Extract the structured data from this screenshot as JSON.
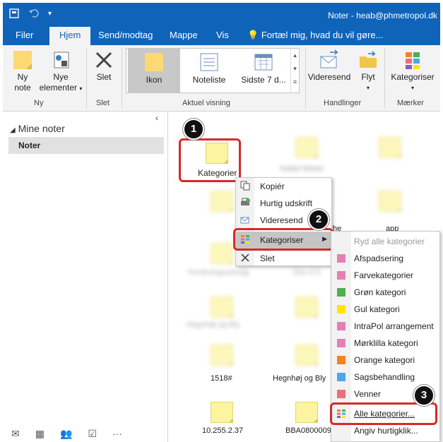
{
  "titlebar": {
    "title": "Noter - heab@phmetropol.dk"
  },
  "tabs": [
    "Filer",
    "Hjem",
    "Send/modtag",
    "Mappe",
    "Vis"
  ],
  "tell_me": "Fortæl mig, hvad du vil gøre...",
  "ribbon": {
    "ny_note_1": "Ny",
    "ny_note_2": "note",
    "nye_elementer_1": "Nye",
    "nye_elementer_2": "elementer",
    "slet": "Slet",
    "view_ikon": "Ikon",
    "view_noteliste": "Noteliste",
    "view_sidste": "Sidste 7 d...",
    "videresend": "Videresend",
    "flyt": "Flyt",
    "kategoriser": "Kategoriser",
    "groups": {
      "ny": "Ny",
      "slet": "Slet",
      "aktuel": "Aktuel visning",
      "handlinger": "Handlinger",
      "maerker": "Mærker"
    }
  },
  "nav": {
    "mine_noter": "Mine noter",
    "noter": "Noter"
  },
  "notes": {
    "selected": "Kategorier",
    "n_1518": "1518#",
    "n_hegnhoj": "Hegnhøj og Bly",
    "n_ip": "10.255.2.37",
    "n_bba": "BBA0800009"
  },
  "context_menu": {
    "kopier": "Kopiér",
    "hurtig": "Hurtig udskrift",
    "videresend": "Videresend",
    "kategoriser": "Kategoriser",
    "slet": "Slet"
  },
  "submenu": {
    "ryd": "Ryd alle kategorier",
    "categories": [
      {
        "label": "Afspadsering",
        "color": "#e37fb3"
      },
      {
        "label": "Farvekategorier",
        "color": "#e37fb3"
      },
      {
        "label": "Grøn kategori",
        "color": "#4caf50"
      },
      {
        "label": "Gul kategori",
        "color": "#ffe600"
      },
      {
        "label": "IntraPol arrangement",
        "color": "#e37fb3"
      },
      {
        "label": "Mørklilla kategori",
        "color": "#e37fb3"
      },
      {
        "label": "Orange kategori",
        "color": "#f58220"
      },
      {
        "label": "Sagsbehandling",
        "color": "#4da6e8"
      },
      {
        "label": "Venner",
        "color": "#e8707a"
      }
    ],
    "alle": "Alle kategorier...",
    "angiv": "Angiv hurtigklik..."
  },
  "badges": {
    "one": "1",
    "two": "2",
    "three": "3"
  },
  "colors": {
    "brand": "#0f64ba",
    "callout": "#d62a2a"
  }
}
